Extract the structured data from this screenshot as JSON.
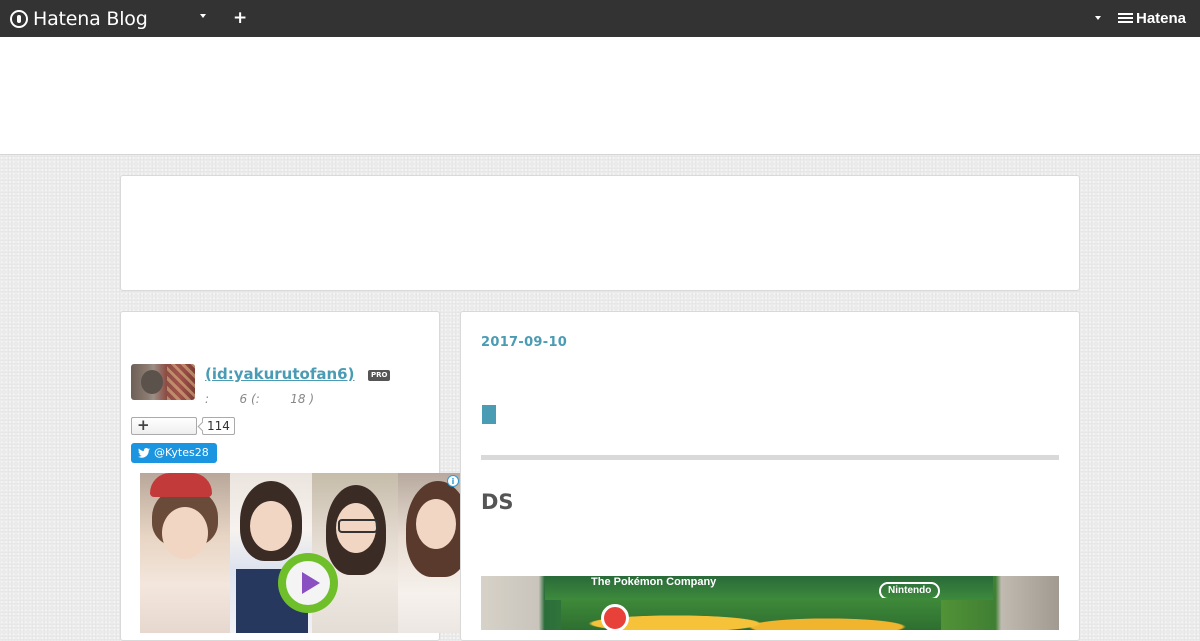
{
  "topbar": {
    "brand": "Hatena Blog",
    "add_label": "+",
    "hatena_brand": "Hatena"
  },
  "profile": {
    "name_link": " (id:yakurutofan6)",
    "pro_badge": "PRO",
    "meta": ":        6 (:        18 )",
    "follow_icon": "+",
    "follow_count": "114",
    "twitter_handle": "@Kytes28"
  },
  "ad": {
    "info_icon": "i",
    "close_icon": "✕"
  },
  "entry": {
    "date": "2017-09-10",
    "section_heading": "DS",
    "image_text_company": "The Pokémon Company",
    "image_text_brand": "Nintendo"
  },
  "colors": {
    "topbar_bg": "#333333",
    "link": "#4a9bb4",
    "twitter": "#1b95e0"
  }
}
